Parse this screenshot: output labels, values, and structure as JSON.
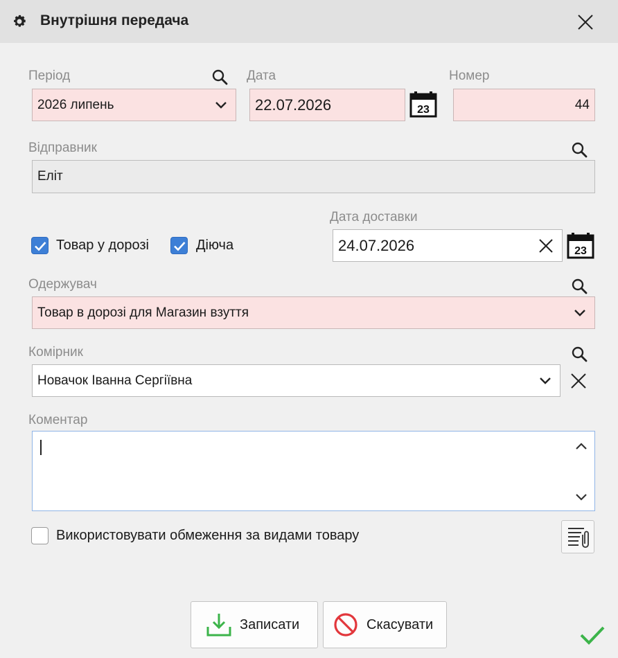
{
  "window": {
    "title": "Внутрішня передача"
  },
  "period": {
    "label": "Період",
    "value": "2026 липень"
  },
  "date": {
    "label": "Дата",
    "value": "22.07.2026"
  },
  "number": {
    "label": "Номер",
    "value": "44"
  },
  "sender": {
    "label": "Відправник",
    "value": "Еліт"
  },
  "checkboxes": {
    "in_transit": {
      "label": "Товар у дорозі",
      "checked": true
    },
    "active": {
      "label": "Діюча",
      "checked": true
    },
    "restrictions": {
      "label": "Використовувати обмеження за видами товару",
      "checked": false
    }
  },
  "delivery_date": {
    "label": "Дата доставки",
    "value": "24.07.2026"
  },
  "receiver": {
    "label": "Одержувач",
    "value": "Товар в дорозі для Магазин взуття"
  },
  "storekeeper": {
    "label": "Комірник",
    "value": "Новачок Іванна Сергіївна"
  },
  "comment": {
    "label": "Коментар",
    "value": ""
  },
  "calendar_day": "23",
  "buttons": {
    "save": "Записати",
    "cancel": "Скасувати"
  },
  "colors": {
    "required_bg": "#fbe2e2",
    "checkbox": "#3d7fd6",
    "save_icon": "#3cb44a",
    "cancel_icon": "#e2373c",
    "ok_check": "#3cb44a"
  },
  "icons": [
    "gear-icon",
    "close-icon",
    "search-icon",
    "chevron-down-icon",
    "calendar-icon",
    "clear-icon",
    "scroll-up-icon",
    "scroll-down-icon",
    "attachment-icon",
    "save-download-icon",
    "cancel-forbidden-icon",
    "checkmark-icon"
  ]
}
